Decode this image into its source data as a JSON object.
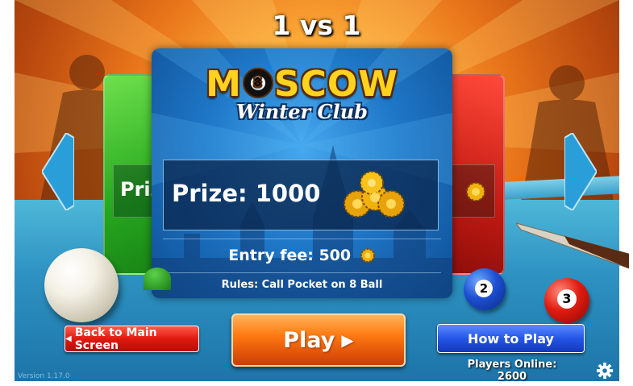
{
  "header": {
    "mode_title": "1 vs 1"
  },
  "carousel": {
    "left_card": {
      "prize_label": "Prize",
      "color": "#2fb52a"
    },
    "right_card": {
      "color": "#d11f15"
    },
    "main_card": {
      "logo": {
        "title_left": "M",
        "title_right": "SCOW",
        "ball_number": "8",
        "subtitle": "Winter Club"
      },
      "prize": "Prize: 1000",
      "entry_fee": "Entry fee: 500",
      "rules": "Rules: Call Pocket on 8 Ball"
    }
  },
  "table": {
    "ball_two": "2",
    "ball_three": "3"
  },
  "buttons": {
    "back": "Back to Main Screen",
    "play": "Play",
    "how_to_play": "How to Play"
  },
  "status": {
    "players_online": "Players Online: 2600",
    "version": "Version 1.17.0"
  },
  "icons": {
    "left_arrow": "chevron-left-icon",
    "right_arrow": "chevron-right-icon",
    "settings": "gear-icon",
    "coins": "coin-stack-icon"
  },
  "colors": {
    "background_orange": "#e8741a",
    "card_blue": "#1f78c8",
    "play_orange": "#ff7a12",
    "back_red": "#e01a10",
    "how_blue": "#2456e6",
    "logo_gold": "#ffd21f"
  }
}
